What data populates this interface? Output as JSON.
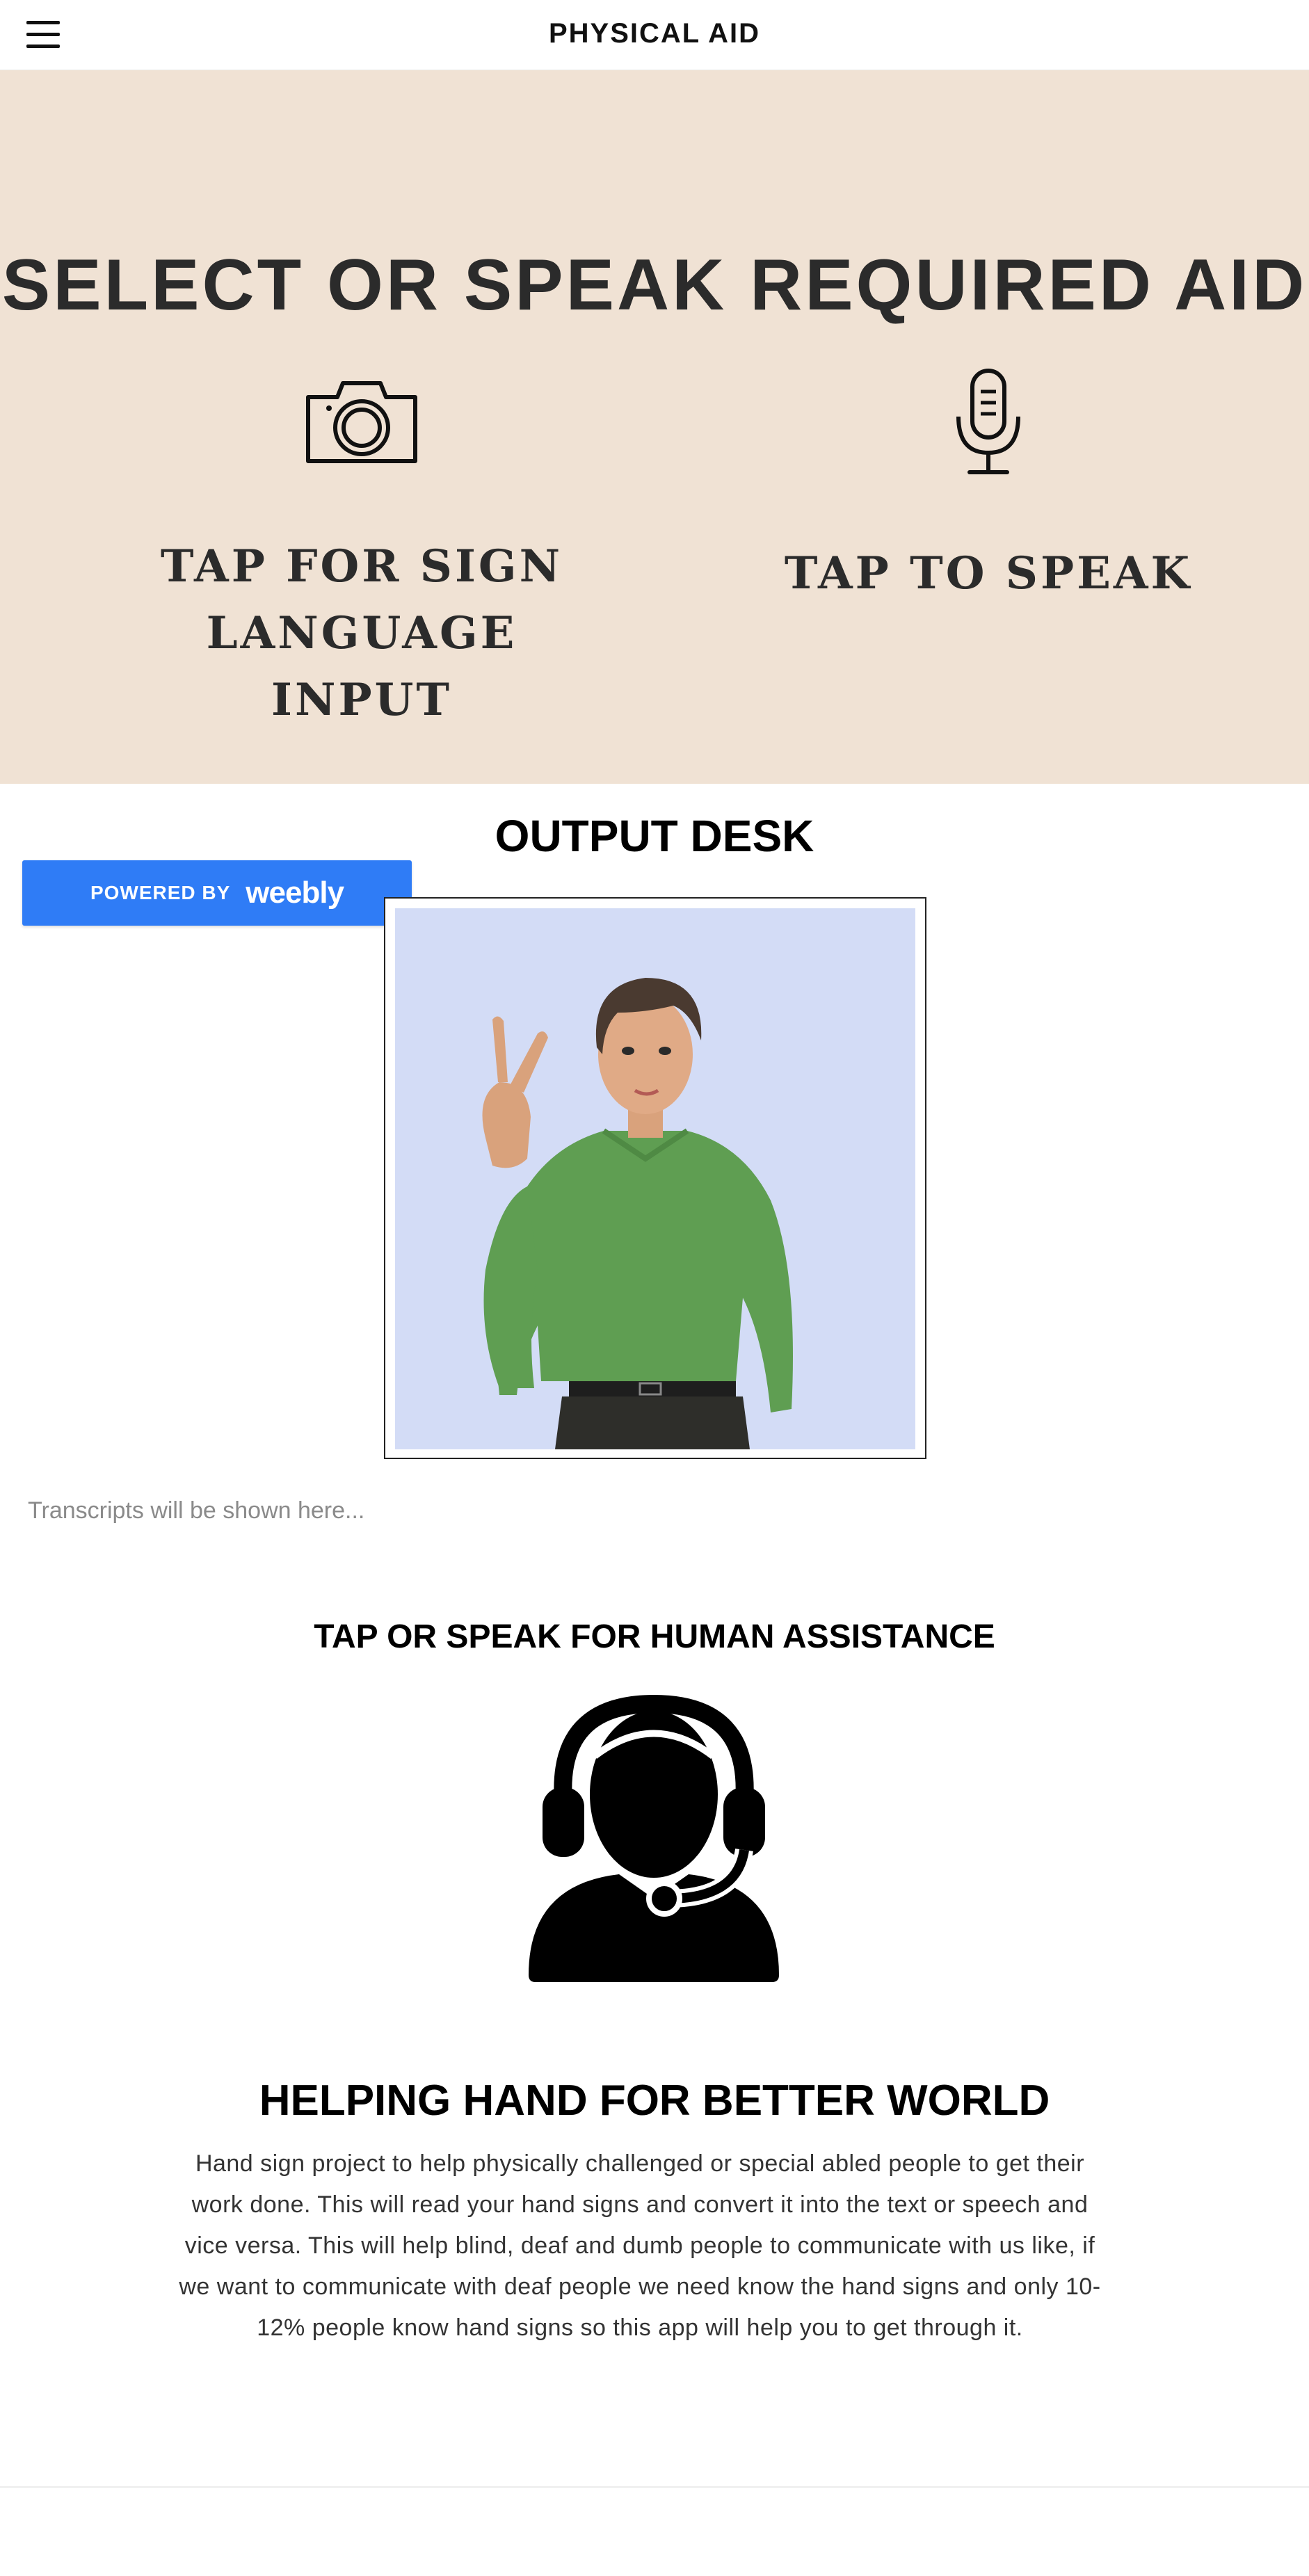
{
  "header": {
    "title": "PHYSICAL AID",
    "menu_icon": "hamburger-menu-icon"
  },
  "hero": {
    "heading": "SELECT OR SPEAK REQUIRED AID",
    "background_color": "#f0e2d4",
    "sign_input": {
      "icon": "camera-icon",
      "label_line1": "TAP FOR SIGN LANGUAGE",
      "label_line2": "INPUT"
    },
    "speak_input": {
      "icon": "microphone-icon",
      "label": "TAP TO SPEAK"
    }
  },
  "output": {
    "title": "OUTPUT DESK",
    "avatar_image": "sign-language-avatar-image",
    "transcript_placeholder": "Transcripts will be shown here..."
  },
  "badge": {
    "powered_by": "POWERED BY",
    "brand": "weebly",
    "color": "#2f7cf6"
  },
  "assistance": {
    "title": "TAP OR SPEAK FOR HUMAN ASSISTANCE",
    "icon": "customer-support-headset-icon"
  },
  "about": {
    "title": "HELPING HAND FOR BETTER WORLD",
    "body": "Hand sign project to help physically challenged or special abled people to get their work done. This will read your hand signs and convert it into the text or speech and vice versa. This will help blind, deaf and dumb people to communicate with us like, if we want to communicate with deaf people we need know the hand signs and only 10-12% people know hand signs so this app will help you to get through it."
  }
}
